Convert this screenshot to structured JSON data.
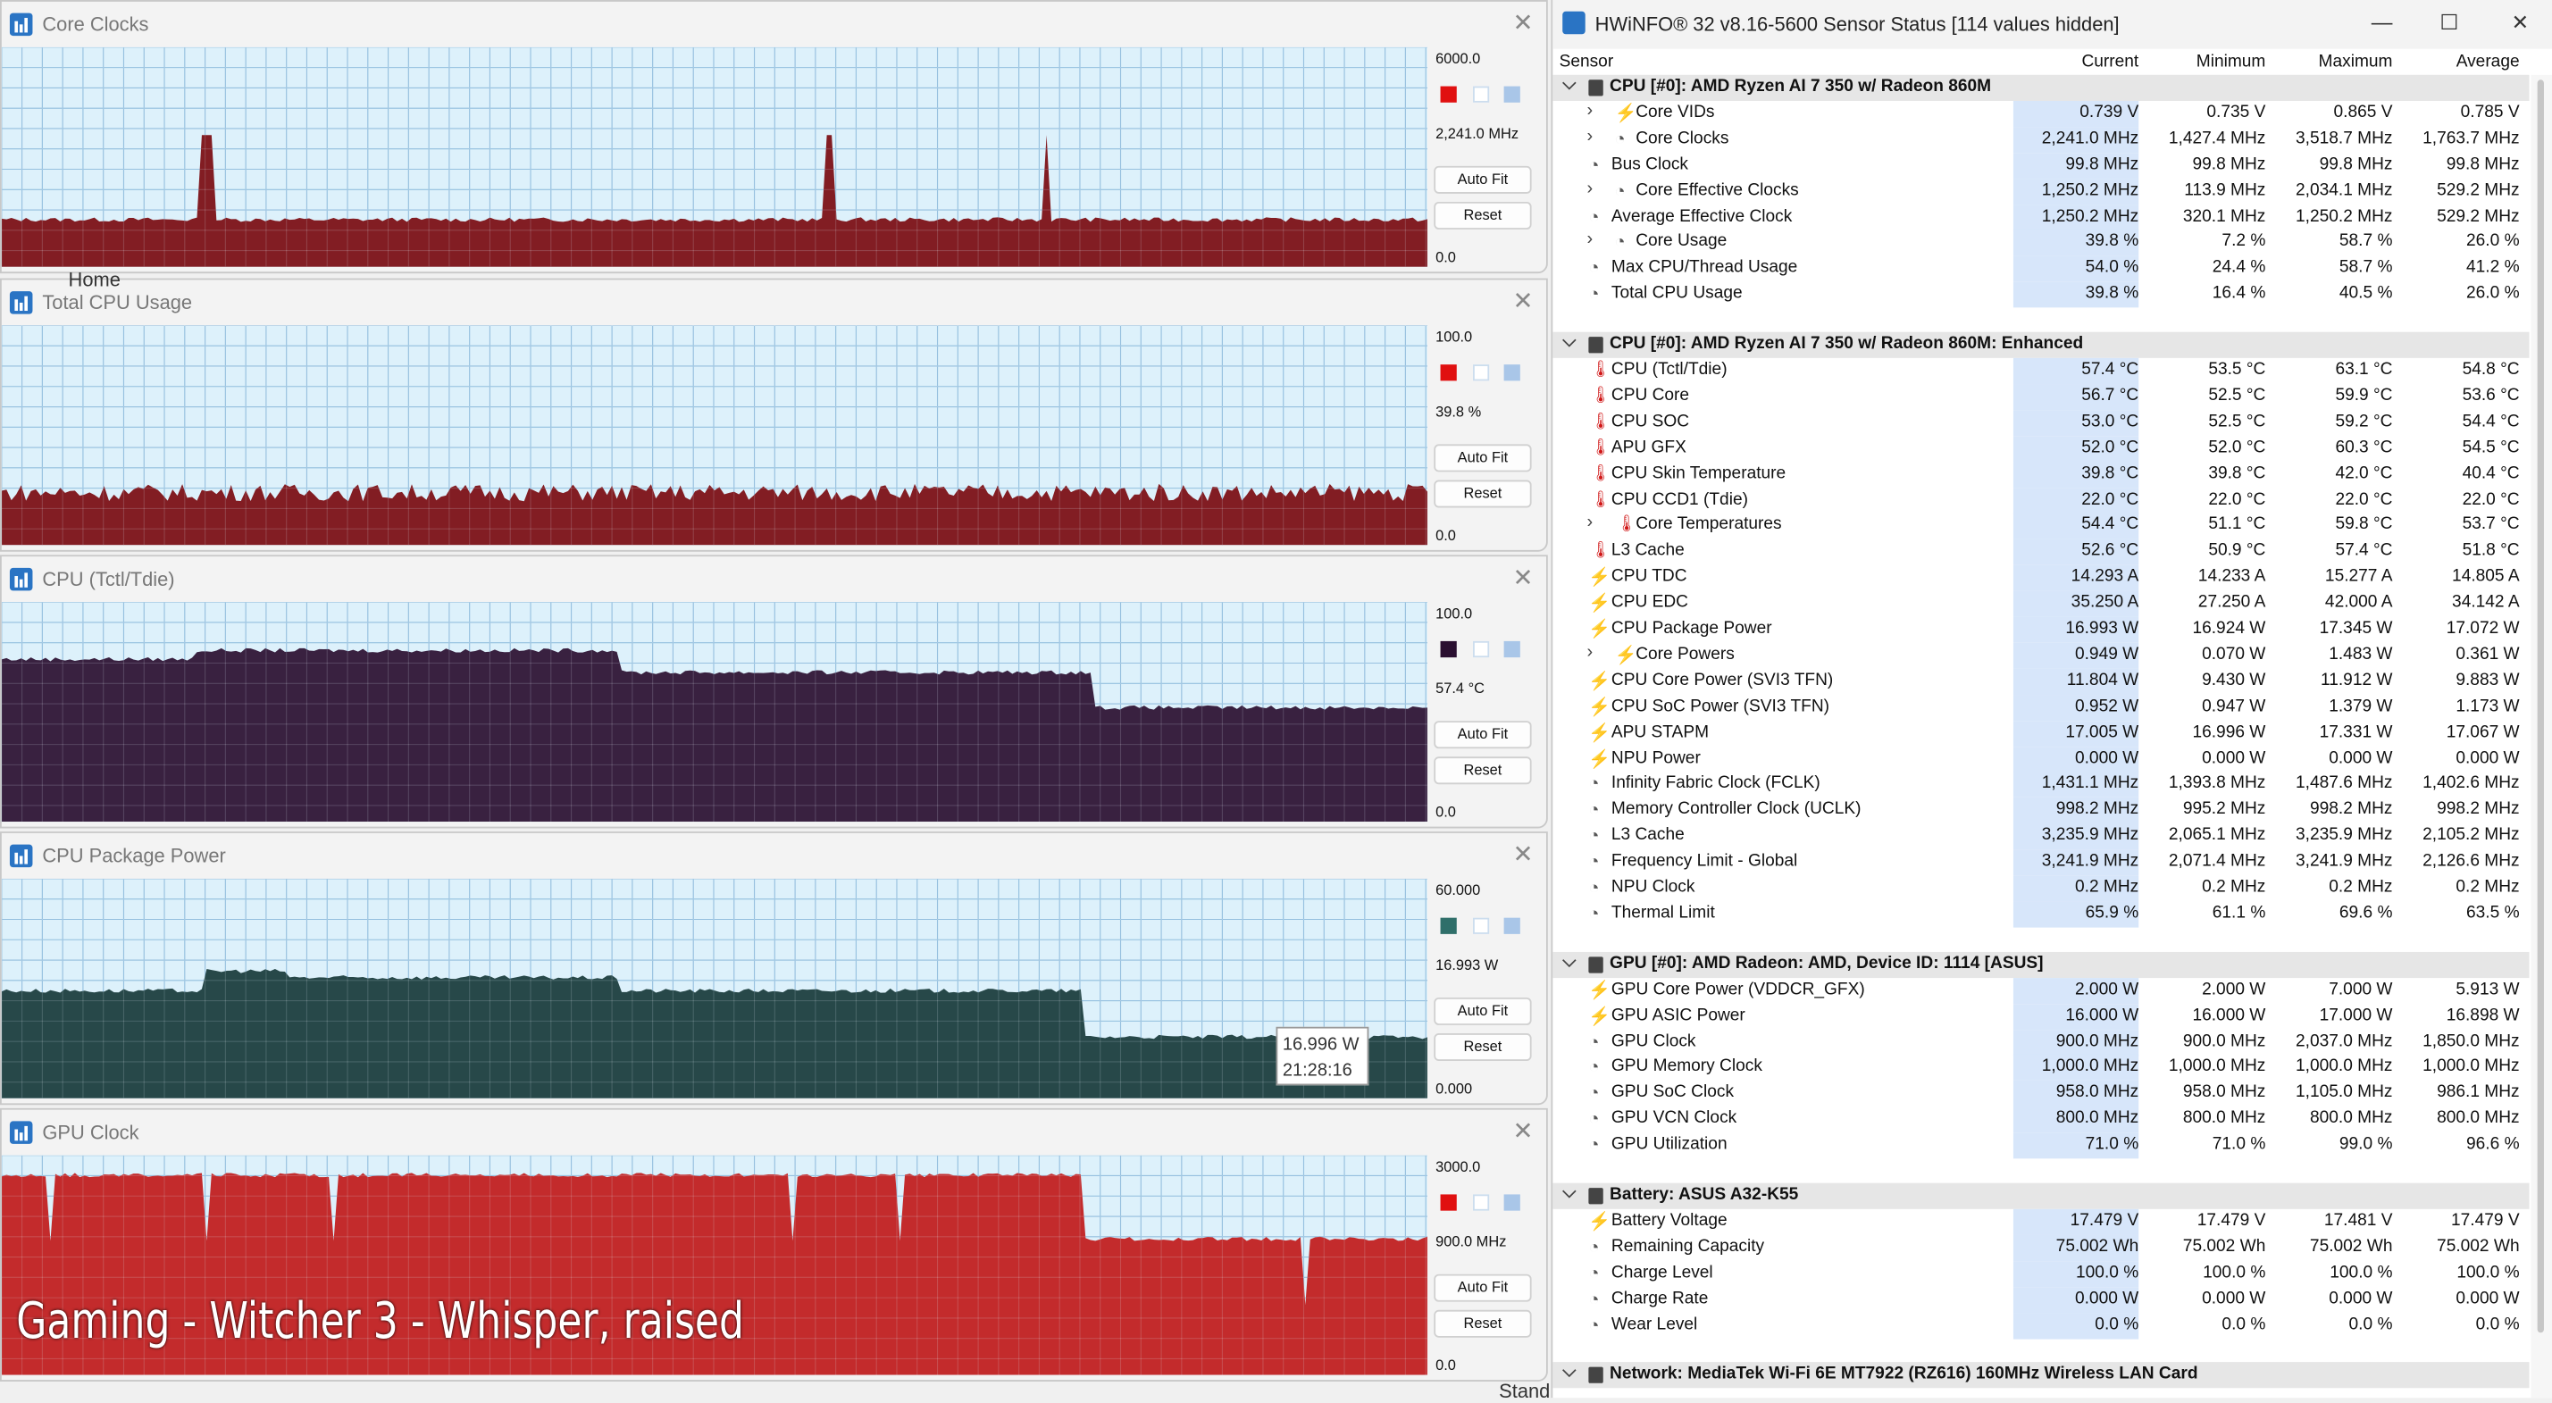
{
  "graphs": [
    {
      "title": "Core Clocks",
      "max": "6000.0",
      "current": "2,241.0 MHz",
      "min": "0.0",
      "color": "#e01010",
      "fill": "#7a0b10",
      "autofit": "Auto Fit",
      "reset": "Reset",
      "level": 0.215
    },
    {
      "title": "Total CPU Usage",
      "max": "100.0",
      "current": "39.8 %",
      "min": "0.0",
      "color": "#e01010",
      "fill": "#7a0b10",
      "autofit": "Auto Fit",
      "reset": "Reset",
      "level": 0.24
    },
    {
      "title": "CPU (Tctl/Tdie)",
      "max": "100.0",
      "current": "57.4 °C",
      "min": "0.0",
      "color": "#2a0f30",
      "fill": "#2a0f30",
      "autofit": "Auto Fit",
      "reset": "Reset",
      "level": 0.55
    },
    {
      "title": "CPU Package Power",
      "max": "60.000",
      "current": "16.993 W",
      "min": "0.000",
      "color": "#2f6f6a",
      "fill": "#173a3a",
      "autofit": "Auto Fit",
      "reset": "Reset",
      "level": 0.28
    },
    {
      "title": "GPU Clock",
      "max": "3000.0",
      "current": "900.0 MHz",
      "min": "0.0",
      "color": "#e01010",
      "fill": "#c01a1a",
      "autofit": "Auto Fit",
      "reset": "Reset",
      "level": 0.55
    }
  ],
  "tooltip": {
    "value": "16.996 W",
    "time": "21:28:16"
  },
  "caption": "Gaming - Witcher 3 - Whisper, raised",
  "ghost": {
    "home": "Home",
    "stand": "Stand"
  },
  "hwinfo": {
    "title": "HWiNFO® 32 v8.16-5600 Sensor Status [114 values hidden]",
    "columns": [
      "Sensor",
      "Current",
      "Minimum",
      "Maximum",
      "Average"
    ],
    "rows": [
      {
        "g": "CPU [#0]: AMD Ryzen AI 7 350 w/ Radeon 860M"
      },
      {
        "n": "Core VIDs",
        "i": "bolt",
        "x": 1,
        "c": "0.739 V",
        "mn": "0.735 V",
        "mx": "0.865 V",
        "a": "0.785 V"
      },
      {
        "n": "Core Clocks",
        "i": "clk",
        "x": 1,
        "c": "2,241.0 MHz",
        "mn": "1,427.4 MHz",
        "mx": "3,518.7 MHz",
        "a": "1,763.7 MHz"
      },
      {
        "n": "Bus Clock",
        "i": "clk",
        "c": "99.8 MHz",
        "mn": "99.8 MHz",
        "mx": "99.8 MHz",
        "a": "99.8 MHz"
      },
      {
        "n": "Core Effective Clocks",
        "i": "clk",
        "x": 1,
        "c": "1,250.2 MHz",
        "mn": "113.9 MHz",
        "mx": "2,034.1 MHz",
        "a": "529.2 MHz"
      },
      {
        "n": "Average Effective Clock",
        "i": "clk",
        "c": "1,250.2 MHz",
        "mn": "320.1 MHz",
        "mx": "1,250.2 MHz",
        "a": "529.2 MHz"
      },
      {
        "n": "Core Usage",
        "i": "clk",
        "x": 1,
        "c": "39.8 %",
        "mn": "7.2 %",
        "mx": "58.7 %",
        "a": "26.0 %"
      },
      {
        "n": "Max CPU/Thread Usage",
        "i": "clk",
        "c": "54.0 %",
        "mn": "24.4 %",
        "mx": "58.7 %",
        "a": "41.2 %"
      },
      {
        "n": "Total CPU Usage",
        "i": "clk",
        "c": "39.8 %",
        "mn": "16.4 %",
        "mx": "40.5 %",
        "a": "26.0 %"
      },
      {
        "blank": 1
      },
      {
        "g": "CPU [#0]: AMD Ryzen AI 7 350 w/ Radeon 860M: Enhanced"
      },
      {
        "n": "CPU (Tctl/Tdie)",
        "i": "therm",
        "c": "57.4 °C",
        "mn": "53.5 °C",
        "mx": "63.1 °C",
        "a": "54.8 °C"
      },
      {
        "n": "CPU Core",
        "i": "therm",
        "c": "56.7 °C",
        "mn": "52.5 °C",
        "mx": "59.9 °C",
        "a": "53.6 °C"
      },
      {
        "n": "CPU SOC",
        "i": "therm",
        "c": "53.0 °C",
        "mn": "52.5 °C",
        "mx": "59.2 °C",
        "a": "54.4 °C"
      },
      {
        "n": "APU GFX",
        "i": "therm",
        "c": "52.0 °C",
        "mn": "52.0 °C",
        "mx": "60.3 °C",
        "a": "54.5 °C"
      },
      {
        "n": "CPU Skin Temperature",
        "i": "therm",
        "c": "39.8 °C",
        "mn": "39.8 °C",
        "mx": "42.0 °C",
        "a": "40.4 °C"
      },
      {
        "n": "CPU CCD1 (Tdie)",
        "i": "therm",
        "c": "22.0 °C",
        "mn": "22.0 °C",
        "mx": "22.0 °C",
        "a": "22.0 °C"
      },
      {
        "n": "Core Temperatures",
        "i": "therm",
        "x": 1,
        "c": "54.4 °C",
        "mn": "51.1 °C",
        "mx": "59.8 °C",
        "a": "53.7 °C"
      },
      {
        "n": "L3 Cache",
        "i": "therm",
        "c": "52.6 °C",
        "mn": "50.9 °C",
        "mx": "57.4 °C",
        "a": "51.8 °C"
      },
      {
        "n": "CPU TDC",
        "i": "bolt",
        "c": "14.293 A",
        "mn": "14.233 A",
        "mx": "15.277 A",
        "a": "14.805 A"
      },
      {
        "n": "CPU EDC",
        "i": "bolt",
        "c": "35.250 A",
        "mn": "27.250 A",
        "mx": "42.000 A",
        "a": "34.142 A"
      },
      {
        "n": "CPU Package Power",
        "i": "bolt",
        "c": "16.993 W",
        "mn": "16.924 W",
        "mx": "17.345 W",
        "a": "17.072 W"
      },
      {
        "n": "Core Powers",
        "i": "bolt",
        "x": 1,
        "c": "0.949 W",
        "mn": "0.070 W",
        "mx": "1.483 W",
        "a": "0.361 W"
      },
      {
        "n": "CPU Core Power (SVI3 TFN)",
        "i": "bolt",
        "c": "11.804 W",
        "mn": "9.430 W",
        "mx": "11.912 W",
        "a": "9.883 W"
      },
      {
        "n": "CPU SoC Power (SVI3 TFN)",
        "i": "bolt",
        "c": "0.952 W",
        "mn": "0.947 W",
        "mx": "1.379 W",
        "a": "1.173 W"
      },
      {
        "n": "APU STAPM",
        "i": "bolt",
        "c": "17.005 W",
        "mn": "16.996 W",
        "mx": "17.331 W",
        "a": "17.067 W"
      },
      {
        "n": "NPU Power",
        "i": "bolt",
        "c": "0.000 W",
        "mn": "0.000 W",
        "mx": "0.000 W",
        "a": "0.000 W"
      },
      {
        "n": "Infinity Fabric Clock (FCLK)",
        "i": "clk",
        "c": "1,431.1 MHz",
        "mn": "1,393.8 MHz",
        "mx": "1,487.6 MHz",
        "a": "1,402.6 MHz"
      },
      {
        "n": "Memory Controller Clock (UCLK)",
        "i": "clk",
        "c": "998.2 MHz",
        "mn": "995.2 MHz",
        "mx": "998.2 MHz",
        "a": "998.2 MHz"
      },
      {
        "n": "L3 Cache",
        "i": "clk",
        "c": "3,235.9 MHz",
        "mn": "2,065.1 MHz",
        "mx": "3,235.9 MHz",
        "a": "2,105.2 MHz"
      },
      {
        "n": "Frequency Limit - Global",
        "i": "clk",
        "c": "3,241.9 MHz",
        "mn": "2,071.4 MHz",
        "mx": "3,241.9 MHz",
        "a": "2,126.6 MHz"
      },
      {
        "n": "NPU Clock",
        "i": "clk",
        "c": "0.2 MHz",
        "mn": "0.2 MHz",
        "mx": "0.2 MHz",
        "a": "0.2 MHz"
      },
      {
        "n": "Thermal Limit",
        "i": "clk",
        "c": "65.9 %",
        "mn": "61.1 %",
        "mx": "69.6 %",
        "a": "63.5 %"
      },
      {
        "blank": 1
      },
      {
        "g": "GPU [#0]: AMD Radeon: AMD, Device ID: 1114 [ASUS]"
      },
      {
        "n": "GPU Core Power (VDDCR_GFX)",
        "i": "bolt",
        "c": "2.000 W",
        "mn": "2.000 W",
        "mx": "7.000 W",
        "a": "5.913 W"
      },
      {
        "n": "GPU ASIC Power",
        "i": "bolt",
        "c": "16.000 W",
        "mn": "16.000 W",
        "mx": "17.000 W",
        "a": "16.898 W"
      },
      {
        "n": "GPU Clock",
        "i": "clk",
        "c": "900.0 MHz",
        "mn": "900.0 MHz",
        "mx": "2,037.0 MHz",
        "a": "1,850.0 MHz"
      },
      {
        "n": "GPU Memory Clock",
        "i": "clk",
        "c": "1,000.0 MHz",
        "mn": "1,000.0 MHz",
        "mx": "1,000.0 MHz",
        "a": "1,000.0 MHz"
      },
      {
        "n": "GPU SoC Clock",
        "i": "clk",
        "c": "958.0 MHz",
        "mn": "958.0 MHz",
        "mx": "1,105.0 MHz",
        "a": "986.1 MHz"
      },
      {
        "n": "GPU VCN Clock",
        "i": "clk",
        "c": "800.0 MHz",
        "mn": "800.0 MHz",
        "mx": "800.0 MHz",
        "a": "800.0 MHz"
      },
      {
        "n": "GPU Utilization",
        "i": "clk",
        "c": "71.0 %",
        "mn": "71.0 %",
        "mx": "99.0 %",
        "a": "96.6 %"
      },
      {
        "blank": 1
      },
      {
        "g": "Battery: ASUS  A32-K55"
      },
      {
        "n": "Battery Voltage",
        "i": "bolt",
        "c": "17.479 V",
        "mn": "17.479 V",
        "mx": "17.481 V",
        "a": "17.479 V"
      },
      {
        "n": "Remaining Capacity",
        "i": "clk",
        "c": "75.002 Wh",
        "mn": "75.002 Wh",
        "mx": "75.002 Wh",
        "a": "75.002 Wh"
      },
      {
        "n": "Charge Level",
        "i": "clk",
        "c": "100.0 %",
        "mn": "100.0 %",
        "mx": "100.0 %",
        "a": "100.0 %"
      },
      {
        "n": "Charge Rate",
        "i": "clk",
        "c": "0.000 W",
        "mn": "0.000 W",
        "mx": "0.000 W",
        "a": "0.000 W"
      },
      {
        "n": "Wear Level",
        "i": "clk",
        "c": "0.0 %",
        "mn": "0.0 %",
        "mx": "0.0 %",
        "a": "0.0 %"
      },
      {
        "blank": 1
      },
      {
        "g": "Network: MediaTek Wi-Fi 6E MT7922 (RZ616) 160MHz Wireless LAN Card"
      }
    ]
  }
}
